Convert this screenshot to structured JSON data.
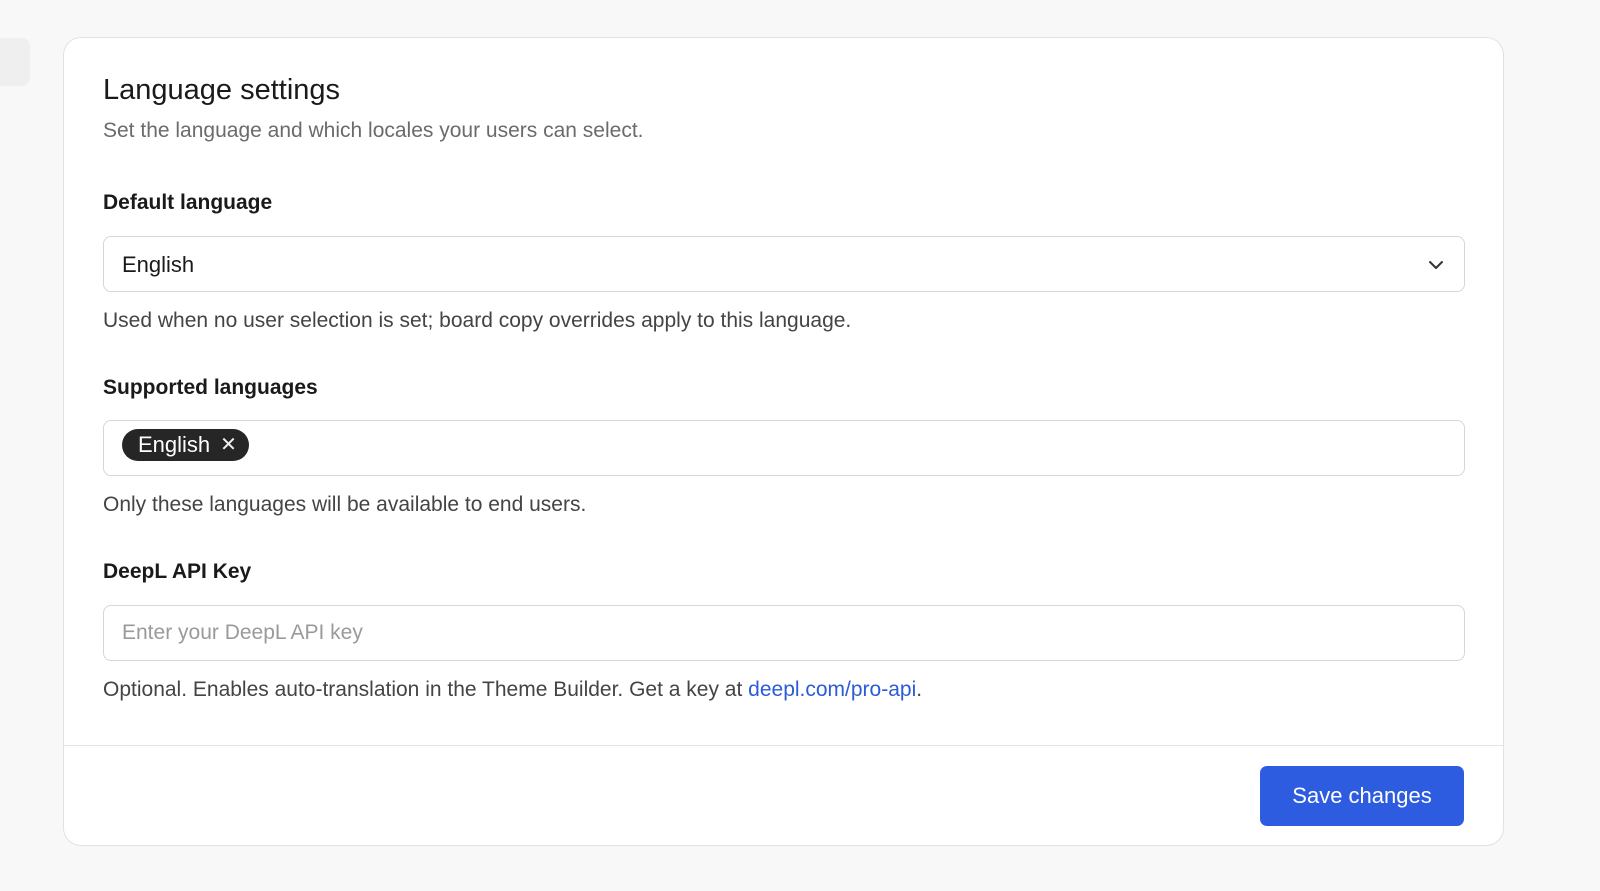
{
  "section": {
    "title": "Language settings",
    "subtitle": "Set the language and which locales your users can select."
  },
  "default_language": {
    "label": "Default language",
    "selected": "English",
    "help": "Used when no user selection is set; board copy overrides apply to this language.",
    "icon": "chevron-down-icon"
  },
  "supported_languages": {
    "label": "Supported languages",
    "chips": [
      {
        "label": "English",
        "remove_glyph": "✕"
      }
    ],
    "help": "Only these languages will be available to end users."
  },
  "deepl": {
    "label": "DeepL API Key",
    "value": "",
    "placeholder": "Enter your DeepL API key",
    "help_prefix": "Optional. Enables auto-translation in the Theme Builder. Get a key at ",
    "help_link": "deepl.com/pro-api",
    "help_suffix": "."
  },
  "footer": {
    "save_label": "Save changes"
  },
  "colors": {
    "primary": "#2e5ce0",
    "link": "#2b5bd7",
    "chip_bg": "#262626"
  }
}
